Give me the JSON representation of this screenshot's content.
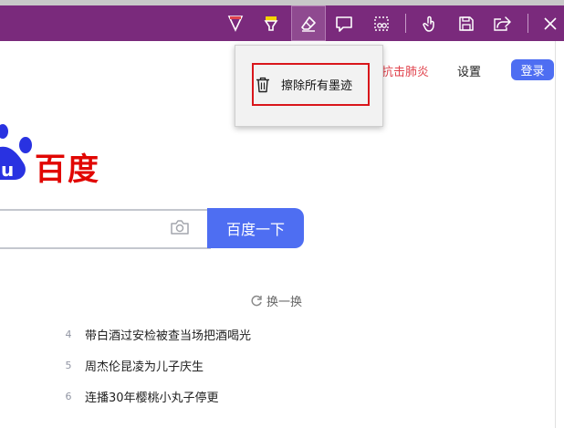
{
  "toolbar": {
    "tools": [
      {
        "name": "ballpoint-pen",
        "icon": "pen-icon",
        "color": "#e0424c"
      },
      {
        "name": "highlighter",
        "icon": "highlighter-icon",
        "color": "#f5d300"
      },
      {
        "name": "eraser",
        "icon": "eraser-icon",
        "active": true
      },
      {
        "name": "add-note",
        "icon": "note-icon"
      },
      {
        "name": "clip",
        "icon": "clip-icon"
      },
      {
        "name": "touch-write",
        "icon": "touch-icon"
      },
      {
        "name": "save",
        "icon": "save-icon"
      },
      {
        "name": "share",
        "icon": "share-icon"
      },
      {
        "name": "exit",
        "icon": "close-icon"
      }
    ],
    "bar_color": "#7a2a7c"
  },
  "eraser_menu": {
    "clear_all_label": "擦除所有墨迹",
    "icon": "trash-icon"
  },
  "nav": {
    "partial_link": "抗击肺炎",
    "settings": "设置",
    "login": "登录"
  },
  "logo": {
    "text": "百度",
    "partial_letters": "u"
  },
  "search": {
    "button_label": "百度一下",
    "placeholder": ""
  },
  "hot": {
    "refresh_label": "换一换",
    "items": [
      {
        "rank": "4",
        "title": "带白酒过安检被查当场把酒喝光"
      },
      {
        "rank": "5",
        "title": "周杰伦昆凌为儿子庆生"
      },
      {
        "rank": "6",
        "title": "连播30年樱桃小丸子停更"
      }
    ]
  }
}
